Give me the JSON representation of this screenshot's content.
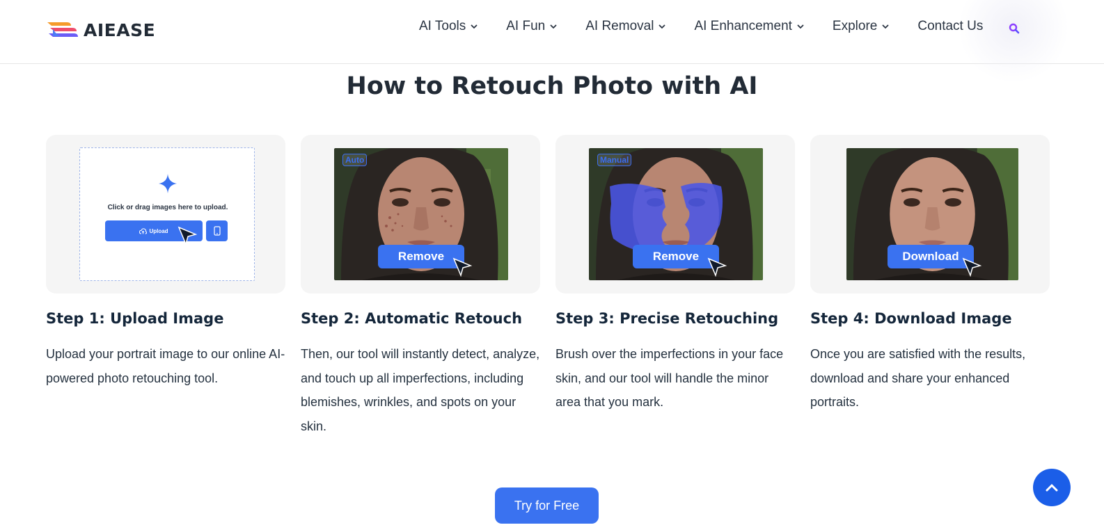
{
  "brand": {
    "name": "AIEASE",
    "colors": {
      "accent": "#3a72f0",
      "dark_text": "#222b36",
      "search": "#8b3dff"
    }
  },
  "nav": {
    "items": [
      {
        "label": "AI Tools",
        "has_dropdown": true
      },
      {
        "label": "AI Fun",
        "has_dropdown": true
      },
      {
        "label": "AI Removal",
        "has_dropdown": true
      },
      {
        "label": "AI Enhancement",
        "has_dropdown": true
      },
      {
        "label": "Explore",
        "has_dropdown": true
      },
      {
        "label": "Contact Us",
        "has_dropdown": false
      }
    ],
    "search_icon": "search-icon"
  },
  "section": {
    "title": "How to Retouch Photo with AI"
  },
  "steps": [
    {
      "title": "Step 1: Upload Image",
      "description": "Upload your portrait image to our online AI-powered photo retouching tool.",
      "upload_hint": "Click or drag images here to upload.",
      "upload_label": "Upload"
    },
    {
      "title": "Step 2: Automatic Retouch",
      "description": "Then, our tool will instantly detect, analyze, and touch up all imperfections, including blemishes, wrinkles, and spots on your skin.",
      "tag": "Auto",
      "action": "Remove"
    },
    {
      "title": "Step 3: Precise Retouching",
      "description": "Brush over the imperfections in your face skin, and our tool will handle the minor area that you mark.",
      "tag": "Manual",
      "action": "Remove"
    },
    {
      "title": "Step 4: Download Image",
      "description": "Once you are satisfied with the results, download and share your enhanced portraits.",
      "action": "Download"
    }
  ],
  "cta": {
    "label": "Try for Free"
  },
  "back_to_top_icon": "chevron-up-icon"
}
